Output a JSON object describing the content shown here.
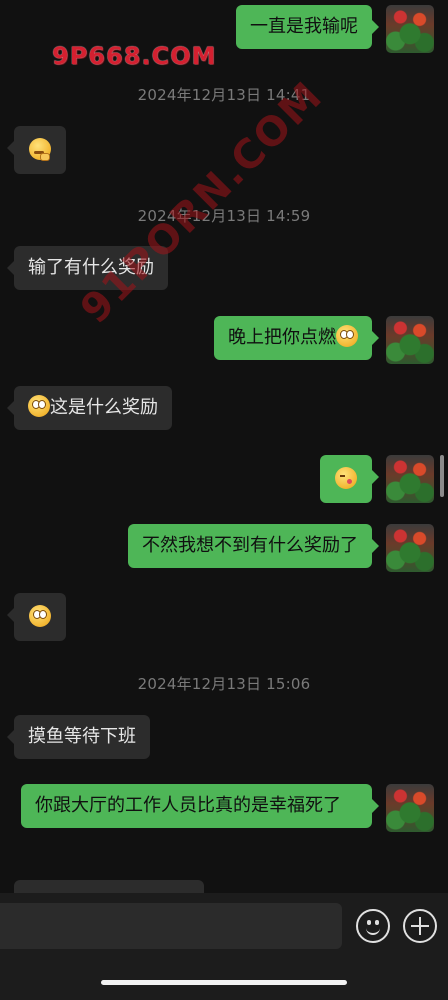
{
  "watermarks": {
    "top": "9P668.COM",
    "diagonal": "91PORN.COM"
  },
  "timestamps": [
    "2024年12月13日 14:41",
    "2024年12月13日 14:59",
    "2024年12月13日 15:06"
  ],
  "messages": [
    {
      "side": "out",
      "text": "一直是我输呢"
    },
    {
      "side": "in",
      "text": "",
      "emoji": "thinking-face"
    },
    {
      "side": "in",
      "text": "输了有什么奖励"
    },
    {
      "side": "out",
      "text": "晚上把你点燃",
      "emoji": "flushed-face"
    },
    {
      "side": "in",
      "text": "这是什么奖励",
      "emoji": "flushed-face"
    },
    {
      "side": "out",
      "text": "",
      "emoji": "winking-tongue-face"
    },
    {
      "side": "out",
      "text": "不然我想不到有什么奖励了"
    },
    {
      "side": "in",
      "text": "",
      "emoji": "flushed-face"
    },
    {
      "side": "in",
      "text": "摸鱼等待下班"
    },
    {
      "side": "out",
      "text": "你跟大厅的工作人员比真的是幸福死了"
    }
  ],
  "input_bar": {
    "emoji_icon": "smiley-icon",
    "more_icon": "plus-circle-icon"
  },
  "colors": {
    "background": "#111111",
    "incoming_bubble": "#2c2c2c",
    "outgoing_bubble": "#4eb657"
  }
}
